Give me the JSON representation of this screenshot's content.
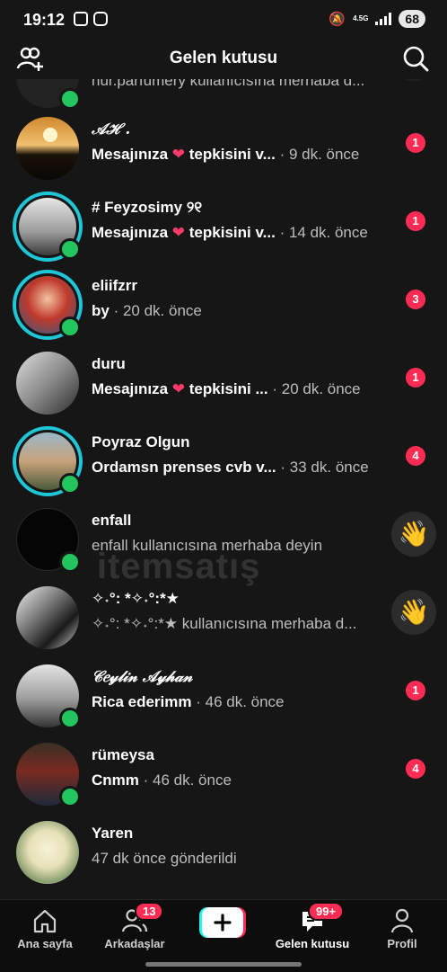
{
  "status_bar": {
    "time": "19:12",
    "network": "4.5G",
    "battery": "68"
  },
  "header": {
    "title": "Gelen kutusu"
  },
  "partial_row": {
    "message": "nur.parfumery kullanıcısına merhaba d..."
  },
  "conversations": [
    {
      "name": "𝒜ℋ .",
      "message_bold": "Mesajınıza",
      "heart": "❤",
      "message_rest": "tepkisini v...",
      "time": "· 9 dk. önce",
      "badge": "1"
    },
    {
      "name": "# Feyzosimy ୨୧",
      "message_bold": "Mesajınıza",
      "heart": "❤",
      "message_rest": "tepkisini v...",
      "time": "· 14 dk. önce",
      "badge": "1"
    },
    {
      "name": "eliifzrr",
      "message_bold": "by",
      "time": "· 20 dk. önce",
      "badge": "3"
    },
    {
      "name": "duru",
      "message_bold": "Mesajınıza",
      "heart": "❤",
      "message_rest": "tepkisini ...",
      "time": "· 20 dk. önce",
      "badge": "1"
    },
    {
      "name": "Poyraz Olgun",
      "message_bold": "Ordamsn prenses cvb v...",
      "time": "· 33 dk. önce",
      "badge": "4"
    },
    {
      "name": "enfall",
      "message": "enfall kullanıcısına merhaba deyin",
      "wave": "👋"
    },
    {
      "name": "✧˖°: *✧˖°:*★",
      "message": "✧˖°: *✧˖°:*★ kullanıcısına merhaba d...",
      "wave": "👋"
    },
    {
      "name": "𝒞𝑒𝓎𝓁𝒾𝓃 𝒜𝓎𝒽𝒶𝓃",
      "message_bold": "Rica ederimm",
      "time": "· 46 dk. önce",
      "badge": "1"
    },
    {
      "name": "rümeysa",
      "message_bold": "Cnmm",
      "time": "· 46 dk. önce",
      "badge": "4"
    },
    {
      "name": "Yaren",
      "message": "47 dk önce gönderildi"
    }
  ],
  "watermark": "itemsatış",
  "tabs": [
    {
      "label": "Ana sayfa"
    },
    {
      "label": "Arkadaşlar",
      "badge": "13"
    },
    {
      "label": "Gelen kutusu",
      "badge": "99+"
    },
    {
      "label": "Profil"
    }
  ],
  "colors": {
    "accent": "#fe2c55",
    "story_ring": "#1ec6d8",
    "online": "#22c55e",
    "background": "#161616"
  }
}
